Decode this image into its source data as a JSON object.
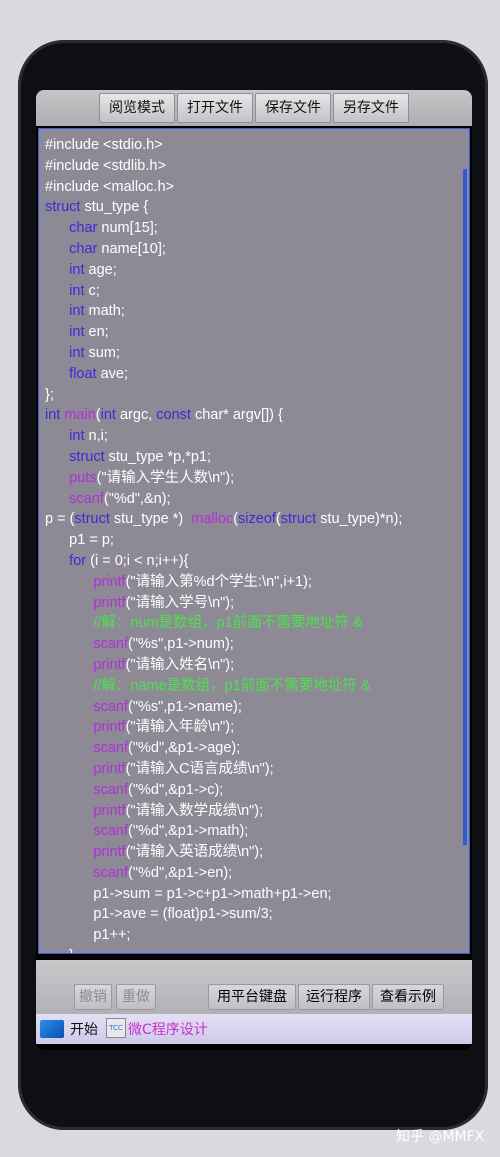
{
  "toolbar": {
    "read_mode": "阅览模式",
    "open_file": "打开文件",
    "save_file": "保存文件",
    "save_as": "另存文件"
  },
  "bottom": {
    "undo": "撤销",
    "redo": "重做",
    "platform_keyboard": "用平台键盘",
    "run": "运行程序",
    "examples": "查看示例"
  },
  "taskbar": {
    "start": "开始",
    "tcc_icon": "TCC",
    "app_title": "微C程序设计"
  },
  "watermark": "知乎 @MMFX",
  "code_lines": [
    [
      [
        "#include <stdio.h>",
        ""
      ]
    ],
    [
      [
        "#include <stdlib.h>",
        ""
      ]
    ],
    [
      [
        "#include <malloc.h>",
        ""
      ]
    ],
    [
      [
        "struct",
        "kw"
      ],
      [
        " stu_type {",
        ""
      ]
    ],
    [
      [
        "      ",
        ""
      ],
      [
        "char",
        "kw"
      ],
      [
        " num[15];",
        ""
      ]
    ],
    [
      [
        "      ",
        ""
      ],
      [
        "char",
        "kw"
      ],
      [
        " name[10];",
        ""
      ]
    ],
    [
      [
        "      ",
        ""
      ],
      [
        "int",
        "kw"
      ],
      [
        " age;",
        ""
      ]
    ],
    [
      [
        "      ",
        ""
      ],
      [
        "int",
        "kw"
      ],
      [
        " c;",
        ""
      ]
    ],
    [
      [
        "      ",
        ""
      ],
      [
        "int",
        "kw"
      ],
      [
        " math;",
        ""
      ]
    ],
    [
      [
        "      ",
        ""
      ],
      [
        "int",
        "kw"
      ],
      [
        " en;",
        ""
      ]
    ],
    [
      [
        "      ",
        ""
      ],
      [
        "int",
        "kw"
      ],
      [
        " sum;",
        ""
      ]
    ],
    [
      [
        "      ",
        ""
      ],
      [
        "float",
        "kw"
      ],
      [
        " ave;",
        ""
      ]
    ],
    [
      [
        "};",
        ""
      ]
    ],
    [
      [
        "int",
        "kw"
      ],
      [
        " ",
        ""
      ],
      [
        "main",
        "fn"
      ],
      [
        "(",
        ""
      ],
      [
        "int",
        "kw"
      ],
      [
        " argc, ",
        ""
      ],
      [
        "const",
        "kw"
      ],
      [
        " char* argv[]) {",
        ""
      ]
    ],
    [
      [
        "      ",
        ""
      ],
      [
        "int",
        "kw"
      ],
      [
        " n,i;",
        ""
      ]
    ],
    [
      [
        "      ",
        ""
      ],
      [
        "struct",
        "kw"
      ],
      [
        " stu_type *p,*p1;",
        ""
      ]
    ],
    [
      [
        "      ",
        ""
      ],
      [
        "puts",
        "fn"
      ],
      [
        "(\"请输入学生人数\\n\");",
        ""
      ]
    ],
    [
      [
        "      ",
        ""
      ],
      [
        "scanf",
        "fn"
      ],
      [
        "(\"%d\",&n);",
        ""
      ]
    ],
    [
      [
        "p = (",
        ""
      ],
      [
        "struct",
        "kw"
      ],
      [
        " stu_type *)  ",
        ""
      ],
      [
        "malloc",
        "fn"
      ],
      [
        "(",
        ""
      ],
      [
        "sizeof",
        "kw"
      ],
      [
        "(",
        ""
      ],
      [
        "struct",
        "kw"
      ],
      [
        " stu_type)*n);",
        ""
      ]
    ],
    [
      [
        "      p1 = p;",
        ""
      ]
    ],
    [
      [
        "      ",
        ""
      ],
      [
        "for",
        "kw"
      ],
      [
        " (i = 0;i < n;i++){",
        ""
      ]
    ],
    [
      [
        "            ",
        ""
      ],
      [
        "printf",
        "fn"
      ],
      [
        "(\"请输入第%d个学生:\\n\",i+1);",
        ""
      ]
    ],
    [
      [
        "            ",
        ""
      ],
      [
        "printf",
        "fn"
      ],
      [
        "(\"请输入学号\\n\");",
        ""
      ]
    ],
    [
      [
        "            ",
        ""
      ],
      [
        "//解：num是数组，p1前面不需要地址符 &",
        "cm"
      ]
    ],
    [
      [
        "            ",
        ""
      ],
      [
        "scanf",
        "fn"
      ],
      [
        "(\"%s\",p1->num);",
        ""
      ]
    ],
    [
      [
        "            ",
        ""
      ],
      [
        "printf",
        "fn"
      ],
      [
        "(\"请输入姓名\\n\");",
        ""
      ]
    ],
    [
      [
        "            ",
        ""
      ],
      [
        "//解：name是数组，p1前面不需要地址符 &",
        "cm"
      ]
    ],
    [
      [
        "            ",
        ""
      ],
      [
        "scanf",
        "fn"
      ],
      [
        "(\"%s\",p1->name);",
        ""
      ]
    ],
    [
      [
        "            ",
        ""
      ],
      [
        "printf",
        "fn"
      ],
      [
        "(\"请输入年龄\\n\");",
        ""
      ]
    ],
    [
      [
        "            ",
        ""
      ],
      [
        "scanf",
        "fn"
      ],
      [
        "(\"%d\",&p1->age);",
        ""
      ]
    ],
    [
      [
        "            ",
        ""
      ],
      [
        "printf",
        "fn"
      ],
      [
        "(\"请输入C语言成绩\\n\");",
        ""
      ]
    ],
    [
      [
        "            ",
        ""
      ],
      [
        "scanf",
        "fn"
      ],
      [
        "(\"%d\",&p1->c);",
        ""
      ]
    ],
    [
      [
        "            ",
        ""
      ],
      [
        "printf",
        "fn"
      ],
      [
        "(\"请输入数学成绩\\n\");",
        ""
      ]
    ],
    [
      [
        "            ",
        ""
      ],
      [
        "scanf",
        "fn"
      ],
      [
        "(\"%d\",&p1->math);",
        ""
      ]
    ],
    [
      [
        "            ",
        ""
      ],
      [
        "printf",
        "fn"
      ],
      [
        "(\"请输入英语成绩\\n\");",
        ""
      ]
    ],
    [
      [
        "            ",
        ""
      ],
      [
        "scanf",
        "fn"
      ],
      [
        "(\"%d\",&p1->en);",
        ""
      ]
    ],
    [
      [
        "            p1->sum = p1->c+p1->math+p1->en;",
        ""
      ]
    ],
    [
      [
        "            p1->ave = (float)p1->sum/3;",
        ""
      ]
    ],
    [
      [
        "            p1++;",
        ""
      ]
    ],
    [
      [
        "      }",
        ""
      ]
    ]
  ],
  "colors": {
    "keyword": "#3a2bd8",
    "function": "#b030d8",
    "comment": "#4ce24a",
    "editor_bg": "#8d8a96"
  }
}
